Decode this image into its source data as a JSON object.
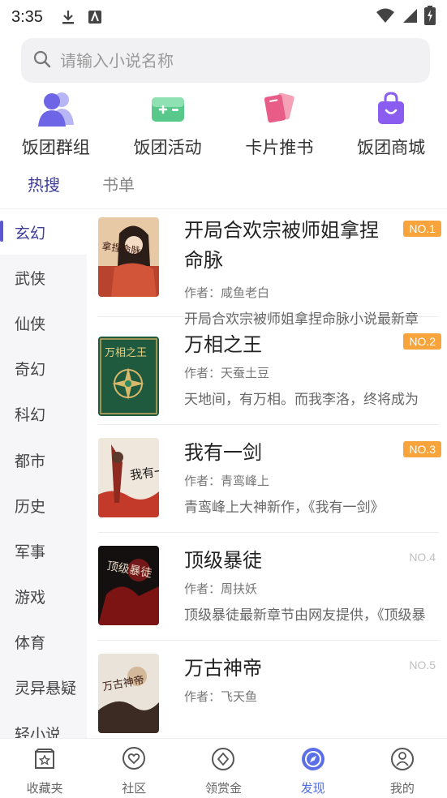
{
  "status_bar": {
    "time": "3:35"
  },
  "search": {
    "placeholder": "请输入小说名称"
  },
  "quick_entries": [
    {
      "label": "饭团群组",
      "icon": "group-icon"
    },
    {
      "label": "饭团活动",
      "icon": "gamepad-icon"
    },
    {
      "label": "卡片推书",
      "icon": "cards-icon"
    },
    {
      "label": "饭团商城",
      "icon": "shopping-bag-icon"
    }
  ],
  "tabs": [
    {
      "label": "热搜",
      "active": true
    },
    {
      "label": "书单",
      "active": false
    }
  ],
  "categories": [
    "玄幻",
    "武侠",
    "仙侠",
    "奇幻",
    "科幻",
    "都市",
    "历史",
    "军事",
    "游戏",
    "体育",
    "灵异悬疑",
    "轻小说"
  ],
  "active_category": "玄幻",
  "books": [
    {
      "title": "开局合欢宗被师姐拿捏命脉",
      "rank": "NO.1",
      "author": "作者：咸鱼老白",
      "desc": "开局合欢宗被师姐拿捏命脉小说最新章",
      "cover_text": "拿捏命脉"
    },
    {
      "title": "万相之王",
      "rank": "NO.2",
      "author": "作者：天蚕土豆",
      "desc": "天地间，有万相。而我李洛，终将成为",
      "cover_text": "万相之王"
    },
    {
      "title": "我有一剑",
      "rank": "NO.3",
      "author": "作者：青鸾峰上",
      "desc": "青鸾峰上大神新作，《我有一剑》",
      "cover_text": "我有一剑"
    },
    {
      "title": "顶级暴徒",
      "rank": "NO.4",
      "author": "作者：周扶妖",
      "desc": "顶级暴徒最新章节由网友提供，《顶级暴",
      "cover_text": "顶级暴徒"
    },
    {
      "title": "万古神帝",
      "rank": "NO.5",
      "author": "作者：飞天鱼",
      "desc": "",
      "cover_text": "万古神帝"
    }
  ],
  "bottom_nav": [
    {
      "label": "收藏夹",
      "icon": "bookshelf-icon",
      "active": false
    },
    {
      "label": "社区",
      "icon": "heart-chat-icon",
      "active": false
    },
    {
      "label": "领赏金",
      "icon": "diamond-icon",
      "active": false
    },
    {
      "label": "发现",
      "icon": "compass-icon",
      "active": true
    },
    {
      "label": "我的",
      "icon": "profile-icon",
      "active": false
    }
  ],
  "colors": {
    "accent": "#5b57d0",
    "rank_badge": "#f7a43c",
    "nav_active": "#4f6de0"
  }
}
